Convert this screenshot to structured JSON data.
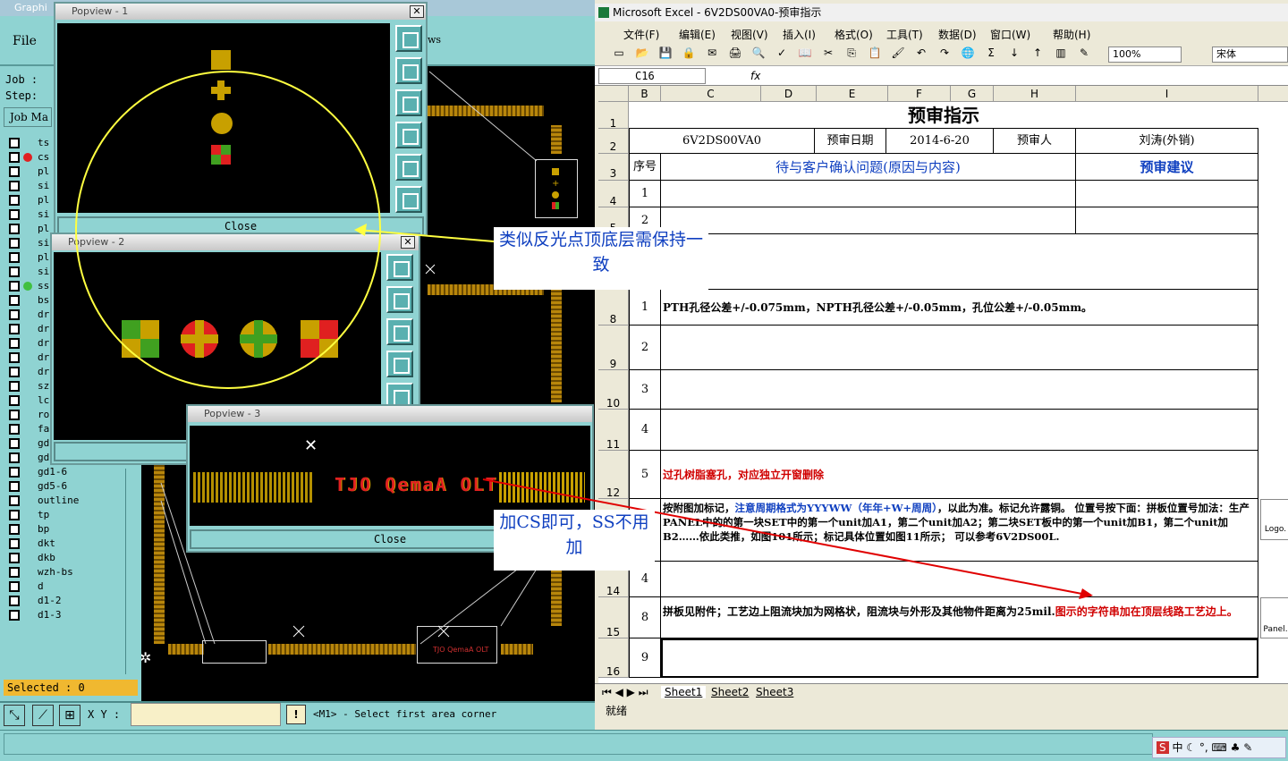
{
  "genesis": {
    "title": "Graphi",
    "file_menu": "File",
    "views_label": "ws",
    "job_label": "Job :",
    "step_label": "Step:",
    "job_manager_label": "Job Ma",
    "layers": [
      {
        "name": "ts",
        "dot": ""
      },
      {
        "name": "cs",
        "dot": "#e02020"
      },
      {
        "name": "pl",
        "dot": ""
      },
      {
        "name": "si",
        "dot": ""
      },
      {
        "name": "pl",
        "dot": ""
      },
      {
        "name": "si",
        "dot": ""
      },
      {
        "name": "pl",
        "dot": ""
      },
      {
        "name": "si",
        "dot": ""
      },
      {
        "name": "pl",
        "dot": ""
      },
      {
        "name": "si",
        "dot": ""
      },
      {
        "name": "ss",
        "dot": "#40c040"
      },
      {
        "name": "bs",
        "dot": ""
      },
      {
        "name": "dr",
        "dot": ""
      },
      {
        "name": "dr",
        "dot": ""
      },
      {
        "name": "dr",
        "dot": ""
      },
      {
        "name": "dr",
        "dot": ""
      },
      {
        "name": "dr",
        "dot": ""
      },
      {
        "name": "sz",
        "dot": ""
      },
      {
        "name": "lc",
        "dot": ""
      },
      {
        "name": "ro",
        "dot": ""
      },
      {
        "name": "fab",
        "dot": ""
      },
      {
        "name": "gd1-2",
        "dot": ""
      },
      {
        "name": "gd1-3",
        "dot": ""
      },
      {
        "name": "gd1-6",
        "dot": ""
      },
      {
        "name": "gd5-6",
        "dot": ""
      },
      {
        "name": "outline",
        "dot": ""
      },
      {
        "name": "tp",
        "dot": ""
      },
      {
        "name": "bp",
        "dot": ""
      },
      {
        "name": "dkt",
        "dot": ""
      },
      {
        "name": "dkb",
        "dot": ""
      },
      {
        "name": "wzh-bs",
        "dot": ""
      },
      {
        "name": "d",
        "dot": ""
      },
      {
        "name": "d1-2",
        "dot": ""
      },
      {
        "name": "d1-3",
        "dot": ""
      }
    ],
    "selected_text": "Selected : 0",
    "xy_label": "X Y :",
    "xy_value": "",
    "warn_label": "!",
    "status_message": "<M1> - Select first area corner"
  },
  "popviews": [
    {
      "title": "Popview - 1",
      "close_label": "Close"
    },
    {
      "title": "Popview - 2",
      "close_label": ""
    },
    {
      "title": "Popview - 3",
      "close_label": "Close",
      "text_on_canvas": "TJO QemaA OLT"
    }
  ],
  "excel": {
    "title": "Microsoft Excel - 6V2DS00VA0-预审指示",
    "menus": [
      "文件(F)",
      "编辑(E)",
      "视图(V)",
      "插入(I)",
      "格式(O)",
      "工具(T)",
      "数据(D)",
      "窗口(W)",
      "帮助(H)"
    ],
    "zoom": "100%",
    "font_name": "宋体",
    "name_box": "C16",
    "fx": "fx",
    "columns": [
      "B",
      "C",
      "D",
      "E",
      "F",
      "G",
      "H",
      "I"
    ],
    "sheet_title": "预审指示",
    "row2": {
      "part": "6V2DS00VA0",
      "date_label": "预审日期",
      "date": "2014-6-20",
      "reviewer_label": "预审人",
      "reviewer": "刘涛(外销)"
    },
    "row3": {
      "seq": "序号",
      "issues": "待与客户确认问题(原因与内容)",
      "suggest": "预审建议"
    },
    "rows": [
      {
        "hdr": "4",
        "seq": "1",
        "text": "",
        "color": "#000"
      },
      {
        "hdr": "5",
        "seq": "2",
        "text": "",
        "color": "#000"
      },
      {
        "hdr": "8",
        "seq": "1",
        "text": "PTH孔径公差+/-0.075mm，NPTH孔径公差+/-0.05mm，孔位公差+/-0.05mm。",
        "color": "#000"
      },
      {
        "hdr": "9",
        "seq": "2",
        "text": "",
        "color": "#000"
      },
      {
        "hdr": "10",
        "seq": "3",
        "text": "",
        "color": "#000"
      },
      {
        "hdr": "11",
        "seq": "4",
        "text": "",
        "color": "#000"
      },
      {
        "hdr": "12",
        "seq": "5",
        "text": "过孔树脂塞孔，对应独立开窗删除",
        "color": "#d00000"
      },
      {
        "hdr": "13",
        "seq": "",
        "text": "",
        "color": "#000"
      },
      {
        "hdr": "14",
        "seq": "4",
        "text": "",
        "color": "#000"
      },
      {
        "hdr": "15",
        "seq": "8",
        "text": "",
        "color": "#000"
      },
      {
        "hdr": "16",
        "seq": "9",
        "text": "",
        "color": "#000"
      }
    ],
    "row13_a": "按附图加标记，",
    "row13_b": "注意周期格式为YYYWW（年年+W+周周）",
    "row13_c": "，以此为准。标记允许露铜。 位置号按下面：拼板位置号加法：生产PANEL中的的第一块SET中的第一个unit加A1，第二个unit加A2；第二块SET板中的第一个unit加B1，第二个unit加B2……依此类推，如图101所示；标记具体位置如图11所示； 可以参考6V2DS00L.",
    "row15_a": "拼板见附件；工艺边上阻流块加为网格状，阻流块与外形及其他物件距离为25mil.",
    "row15_b": "图示的字符串加在顶层线路工艺边上。",
    "logo_label": "Logo.",
    "panel_label": "Panel.",
    "sheets": [
      "Sheet1",
      "Sheet2",
      "Sheet3"
    ],
    "status": "就绪"
  },
  "annotations": {
    "callout_1": "类似反光点顶底层需保持一致",
    "callout_2": "加CS即可，SS不用加"
  },
  "tray": {
    "ime": "中"
  },
  "colors": {
    "genesis_panel": "#8fd3d2",
    "pad_gold": "#c8a000",
    "callout_text": "#1040c0",
    "arrow_red": "#e00000",
    "ellipse_yellow": "#ffff40"
  }
}
